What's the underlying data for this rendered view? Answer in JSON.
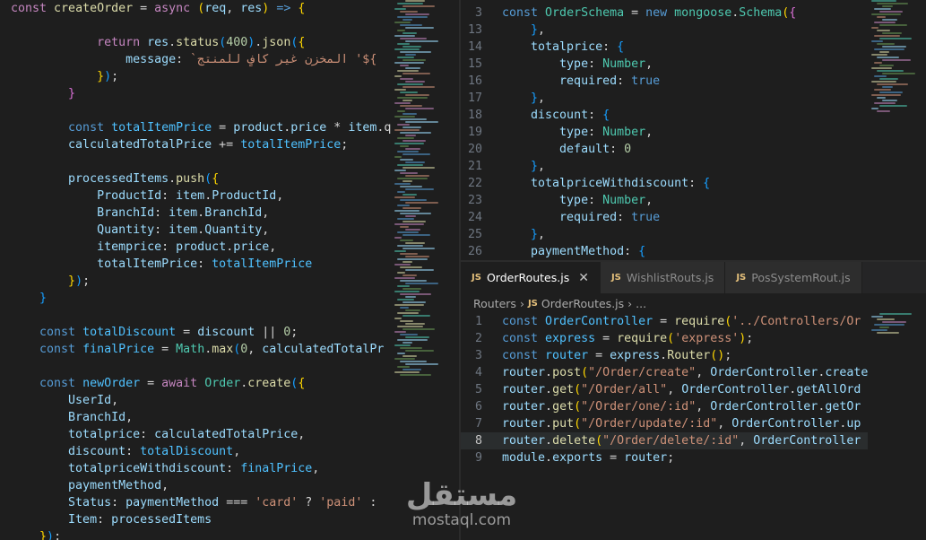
{
  "left_editor": {
    "lines": [
      [
        [
          "k",
          "const "
        ],
        [
          "f",
          "createOrder"
        ],
        [
          "p",
          " = "
        ],
        [
          "k",
          "async "
        ],
        [
          "b1",
          "("
        ],
        [
          "v",
          "req"
        ],
        [
          "p",
          ", "
        ],
        [
          "v",
          "res"
        ],
        [
          "b1",
          ")"
        ],
        [
          "p",
          " "
        ],
        [
          "kb",
          "=>"
        ],
        [
          "p",
          " "
        ],
        [
          "b1",
          "{"
        ]
      ],
      [
        [
          "p",
          "                "
        ],
        [
          "p",
          "                          "
        ]
      ],
      [
        [
          "p",
          "            "
        ],
        [
          "k",
          "return "
        ],
        [
          "v",
          "res"
        ],
        [
          "p",
          "."
        ],
        [
          "f",
          "status"
        ],
        [
          "b3",
          "("
        ],
        [
          "n",
          "400"
        ],
        [
          "b3",
          ")"
        ],
        [
          "p",
          "."
        ],
        [
          "f",
          "json"
        ],
        [
          "b3",
          "("
        ],
        [
          "b1",
          "{"
        ]
      ],
      [
        [
          "p",
          "                "
        ],
        [
          "v",
          "message"
        ],
        [
          "p",
          ": "
        ],
        [
          "s",
          "`المخزن غير كافٍ للمنتج '${"
        ]
      ],
      [
        [
          "p",
          "            "
        ],
        [
          "b1",
          "}"
        ],
        [
          "b3",
          ")"
        ],
        [
          "p",
          ";"
        ]
      ],
      [
        [
          "p",
          "        "
        ],
        [
          "b2",
          "}"
        ]
      ],
      [
        [
          "p",
          ""
        ]
      ],
      [
        [
          "p",
          "        "
        ],
        [
          "kb",
          "const "
        ],
        [
          "ob",
          "totalItemPrice"
        ],
        [
          "p",
          " = "
        ],
        [
          "v",
          "product"
        ],
        [
          "p",
          "."
        ],
        [
          "v",
          "price"
        ],
        [
          "p",
          " * "
        ],
        [
          "v",
          "item"
        ],
        [
          "p",
          ".q"
        ]
      ],
      [
        [
          "p",
          "        "
        ],
        [
          "v",
          "calculatedTotalPrice"
        ],
        [
          "p",
          " += "
        ],
        [
          "ob",
          "totalItemPrice"
        ],
        [
          "p",
          ";"
        ]
      ],
      [
        [
          "p",
          ""
        ]
      ],
      [
        [
          "p",
          "        "
        ],
        [
          "v",
          "processedItems"
        ],
        [
          "p",
          "."
        ],
        [
          "f",
          "push"
        ],
        [
          "b3",
          "("
        ],
        [
          "b1",
          "{"
        ]
      ],
      [
        [
          "p",
          "            "
        ],
        [
          "v",
          "ProductId"
        ],
        [
          "p",
          ": "
        ],
        [
          "v",
          "item"
        ],
        [
          "p",
          "."
        ],
        [
          "v",
          "ProductId"
        ],
        [
          "p",
          ","
        ]
      ],
      [
        [
          "p",
          "            "
        ],
        [
          "v",
          "BranchId"
        ],
        [
          "p",
          ": "
        ],
        [
          "v",
          "item"
        ],
        [
          "p",
          "."
        ],
        [
          "v",
          "BranchId"
        ],
        [
          "p",
          ","
        ]
      ],
      [
        [
          "p",
          "            "
        ],
        [
          "v",
          "Quantity"
        ],
        [
          "p",
          ": "
        ],
        [
          "v",
          "item"
        ],
        [
          "p",
          "."
        ],
        [
          "v",
          "Quantity"
        ],
        [
          "p",
          ","
        ]
      ],
      [
        [
          "p",
          "            "
        ],
        [
          "v",
          "itemprice"
        ],
        [
          "p",
          ": "
        ],
        [
          "v",
          "product"
        ],
        [
          "p",
          "."
        ],
        [
          "v",
          "price"
        ],
        [
          "p",
          ","
        ]
      ],
      [
        [
          "p",
          "            "
        ],
        [
          "v",
          "totalItemPrice"
        ],
        [
          "p",
          ": "
        ],
        [
          "ob",
          "totalItemPrice"
        ]
      ],
      [
        [
          "p",
          "        "
        ],
        [
          "b1",
          "}"
        ],
        [
          "b3",
          ")"
        ],
        [
          "p",
          ";"
        ]
      ],
      [
        [
          "p",
          "    "
        ],
        [
          "b3",
          "}"
        ]
      ],
      [
        [
          "p",
          ""
        ]
      ],
      [
        [
          "p",
          "    "
        ],
        [
          "kb",
          "const "
        ],
        [
          "ob",
          "totalDiscount"
        ],
        [
          "p",
          " = "
        ],
        [
          "v",
          "discount"
        ],
        [
          "p",
          " || "
        ],
        [
          "n",
          "0"
        ],
        [
          "p",
          ";"
        ]
      ],
      [
        [
          "p",
          "    "
        ],
        [
          "kb",
          "const "
        ],
        [
          "ob",
          "finalPrice"
        ],
        [
          "p",
          " = "
        ],
        [
          "c",
          "Math"
        ],
        [
          "p",
          "."
        ],
        [
          "f",
          "max"
        ],
        [
          "b3",
          "("
        ],
        [
          "n",
          "0"
        ],
        [
          "p",
          ", "
        ],
        [
          "v",
          "calculatedTotalPr"
        ]
      ],
      [
        [
          "p",
          ""
        ]
      ],
      [
        [
          "p",
          "    "
        ],
        [
          "kb",
          "const "
        ],
        [
          "ob",
          "newOrder"
        ],
        [
          "p",
          " = "
        ],
        [
          "k",
          "await "
        ],
        [
          "c",
          "Order"
        ],
        [
          "p",
          "."
        ],
        [
          "f",
          "create"
        ],
        [
          "b3",
          "("
        ],
        [
          "b1",
          "{"
        ]
      ],
      [
        [
          "p",
          "        "
        ],
        [
          "v",
          "UserId"
        ],
        [
          "p",
          ","
        ]
      ],
      [
        [
          "p",
          "        "
        ],
        [
          "v",
          "BranchId"
        ],
        [
          "p",
          ","
        ]
      ],
      [
        [
          "p",
          "        "
        ],
        [
          "v",
          "totalprice"
        ],
        [
          "p",
          ": "
        ],
        [
          "v",
          "calculatedTotalPrice"
        ],
        [
          "p",
          ","
        ]
      ],
      [
        [
          "p",
          "        "
        ],
        [
          "v",
          "discount"
        ],
        [
          "p",
          ": "
        ],
        [
          "ob",
          "totalDiscount"
        ],
        [
          "p",
          ","
        ]
      ],
      [
        [
          "p",
          "        "
        ],
        [
          "v",
          "totalpriceWithdiscount"
        ],
        [
          "p",
          ": "
        ],
        [
          "ob",
          "finalPrice"
        ],
        [
          "p",
          ","
        ]
      ],
      [
        [
          "p",
          "        "
        ],
        [
          "v",
          "paymentMethod"
        ],
        [
          "p",
          ","
        ]
      ],
      [
        [
          "p",
          "        "
        ],
        [
          "v",
          "Status"
        ],
        [
          "p",
          ": "
        ],
        [
          "v",
          "paymentMethod"
        ],
        [
          "p",
          " === "
        ],
        [
          "s",
          "'card'"
        ],
        [
          "p",
          " ? "
        ],
        [
          "s",
          "'paid'"
        ],
        [
          "p",
          " : "
        ]
      ],
      [
        [
          "p",
          "        "
        ],
        [
          "v",
          "Item"
        ],
        [
          "p",
          ": "
        ],
        [
          "v",
          "processedItems"
        ]
      ],
      [
        [
          "p",
          "    "
        ],
        [
          "b1",
          "}"
        ],
        [
          "b3",
          ")"
        ],
        [
          "p",
          ";"
        ]
      ]
    ]
  },
  "schema_editor": {
    "sticky_number": "3",
    "sticky_line": [
      [
        "kb",
        "const "
      ],
      [
        "c",
        "OrderSchema"
      ],
      [
        "p",
        " = "
      ],
      [
        "kb",
        "new "
      ],
      [
        "c",
        "mongoose"
      ],
      [
        "p",
        "."
      ],
      [
        "c",
        "Schema"
      ],
      [
        "b1",
        "("
      ],
      [
        "b2",
        "{"
      ]
    ],
    "numbers": [
      "13",
      "14",
      "15",
      "16",
      "17",
      "18",
      "19",
      "20",
      "21",
      "22",
      "23",
      "24",
      "25",
      "26"
    ],
    "lines": [
      [
        [
          "p",
          "    "
        ],
        [
          "b3",
          "}"
        ],
        [
          "p",
          ","
        ]
      ],
      [
        [
          "p",
          "    "
        ],
        [
          "v",
          "totalprice"
        ],
        [
          "p",
          ": "
        ],
        [
          "b3",
          "{"
        ]
      ],
      [
        [
          "p",
          "        "
        ],
        [
          "v",
          "type"
        ],
        [
          "p",
          ": "
        ],
        [
          "c",
          "Number"
        ],
        [
          "p",
          ","
        ]
      ],
      [
        [
          "p",
          "        "
        ],
        [
          "v",
          "required"
        ],
        [
          "p",
          ": "
        ],
        [
          "kb",
          "true"
        ]
      ],
      [
        [
          "p",
          "    "
        ],
        [
          "b3",
          "}"
        ],
        [
          "p",
          ","
        ]
      ],
      [
        [
          "p",
          "    "
        ],
        [
          "v",
          "discount"
        ],
        [
          "p",
          ": "
        ],
        [
          "b3",
          "{"
        ]
      ],
      [
        [
          "p",
          "        "
        ],
        [
          "v",
          "type"
        ],
        [
          "p",
          ": "
        ],
        [
          "c",
          "Number"
        ],
        [
          "p",
          ","
        ]
      ],
      [
        [
          "p",
          "        "
        ],
        [
          "v",
          "default"
        ],
        [
          "p",
          ": "
        ],
        [
          "n",
          "0"
        ]
      ],
      [
        [
          "p",
          "    "
        ],
        [
          "b3",
          "}"
        ],
        [
          "p",
          ","
        ]
      ],
      [
        [
          "p",
          "    "
        ],
        [
          "v",
          "totalpriceWithdiscount"
        ],
        [
          "p",
          ": "
        ],
        [
          "b3",
          "{"
        ]
      ],
      [
        [
          "p",
          "        "
        ],
        [
          "v",
          "type"
        ],
        [
          "p",
          ": "
        ],
        [
          "c",
          "Number"
        ],
        [
          "p",
          ","
        ]
      ],
      [
        [
          "p",
          "        "
        ],
        [
          "v",
          "required"
        ],
        [
          "p",
          ": "
        ],
        [
          "kb",
          "true"
        ]
      ],
      [
        [
          "p",
          "    "
        ],
        [
          "b3",
          "}"
        ],
        [
          "p",
          ","
        ]
      ],
      [
        [
          "p",
          "    "
        ],
        [
          "v",
          "paymentMethod"
        ],
        [
          "p",
          ": "
        ],
        [
          "b3",
          "{"
        ]
      ]
    ]
  },
  "tabs": [
    {
      "badge": "JS",
      "label": "OrderRoutes.js",
      "close": "✕"
    },
    {
      "badge": "JS",
      "label": "WishlistRouts.js"
    },
    {
      "badge": "JS",
      "label": "PosSystemRout.js"
    }
  ],
  "breadcrumb": {
    "folder": "Routers",
    "sep": "›",
    "badge": "JS",
    "file": "OrderRoutes.js",
    "sep2": "›",
    "more": "..."
  },
  "routes_editor": {
    "numbers": [
      "1",
      "2",
      "3",
      "4",
      "5",
      "6",
      "7",
      "8",
      "9"
    ],
    "active_line": 8,
    "lines": [
      [
        [
          "kb",
          "const "
        ],
        [
          "ob",
          "OrderController"
        ],
        [
          "p",
          " = "
        ],
        [
          "f",
          "require"
        ],
        [
          "b1",
          "("
        ],
        [
          "s",
          "'../Controllers/Or"
        ]
      ],
      [
        [
          "kb",
          "const "
        ],
        [
          "ob",
          "express"
        ],
        [
          "p",
          " = "
        ],
        [
          "f",
          "require"
        ],
        [
          "b1",
          "("
        ],
        [
          "s",
          "'express'"
        ],
        [
          "b1",
          ")"
        ],
        [
          "p",
          ";"
        ]
      ],
      [
        [
          "kb",
          "const "
        ],
        [
          "ob",
          "router"
        ],
        [
          "p",
          " = "
        ],
        [
          "v",
          "express"
        ],
        [
          "p",
          "."
        ],
        [
          "f",
          "Router"
        ],
        [
          "b1",
          "("
        ],
        [
          "b1",
          ")"
        ],
        [
          "p",
          ";"
        ]
      ],
      [
        [
          "v",
          "router"
        ],
        [
          "p",
          "."
        ],
        [
          "f",
          "post"
        ],
        [
          "b1",
          "("
        ],
        [
          "s",
          "\"/Order/create\""
        ],
        [
          "p",
          ", "
        ],
        [
          "v",
          "OrderController"
        ],
        [
          "p",
          "."
        ],
        [
          "v",
          "create"
        ]
      ],
      [
        [
          "v",
          "router"
        ],
        [
          "p",
          "."
        ],
        [
          "f",
          "get"
        ],
        [
          "b1",
          "("
        ],
        [
          "s",
          "\"/Order/all\""
        ],
        [
          "p",
          ", "
        ],
        [
          "v",
          "OrderController"
        ],
        [
          "p",
          "."
        ],
        [
          "v",
          "getAllOrd"
        ]
      ],
      [
        [
          "v",
          "router"
        ],
        [
          "p",
          "."
        ],
        [
          "f",
          "get"
        ],
        [
          "b1",
          "("
        ],
        [
          "s",
          "\"/Order/one/:id\""
        ],
        [
          "p",
          ", "
        ],
        [
          "v",
          "OrderController"
        ],
        [
          "p",
          "."
        ],
        [
          "v",
          "getOr"
        ]
      ],
      [
        [
          "v",
          "router"
        ],
        [
          "p",
          "."
        ],
        [
          "f",
          "put"
        ],
        [
          "b1",
          "("
        ],
        [
          "s",
          "\"/Order/update/:id\""
        ],
        [
          "p",
          ", "
        ],
        [
          "v",
          "OrderController"
        ],
        [
          "p",
          "."
        ],
        [
          "v",
          "up"
        ]
      ],
      [
        [
          "v",
          "router"
        ],
        [
          "p",
          "."
        ],
        [
          "f",
          "delete"
        ],
        [
          "b1",
          "("
        ],
        [
          "s",
          "\"/Order/delete/:id\""
        ],
        [
          "p",
          ", "
        ],
        [
          "v",
          "OrderController"
        ]
      ],
      [
        [
          "v",
          "module"
        ],
        [
          "p",
          "."
        ],
        [
          "v",
          "exports"
        ],
        [
          "p",
          " = "
        ],
        [
          "v",
          "router"
        ],
        [
          "p",
          ";"
        ]
      ]
    ]
  },
  "watermark": {
    "arabic": "مستقل",
    "latin": "mostaql.com"
  }
}
